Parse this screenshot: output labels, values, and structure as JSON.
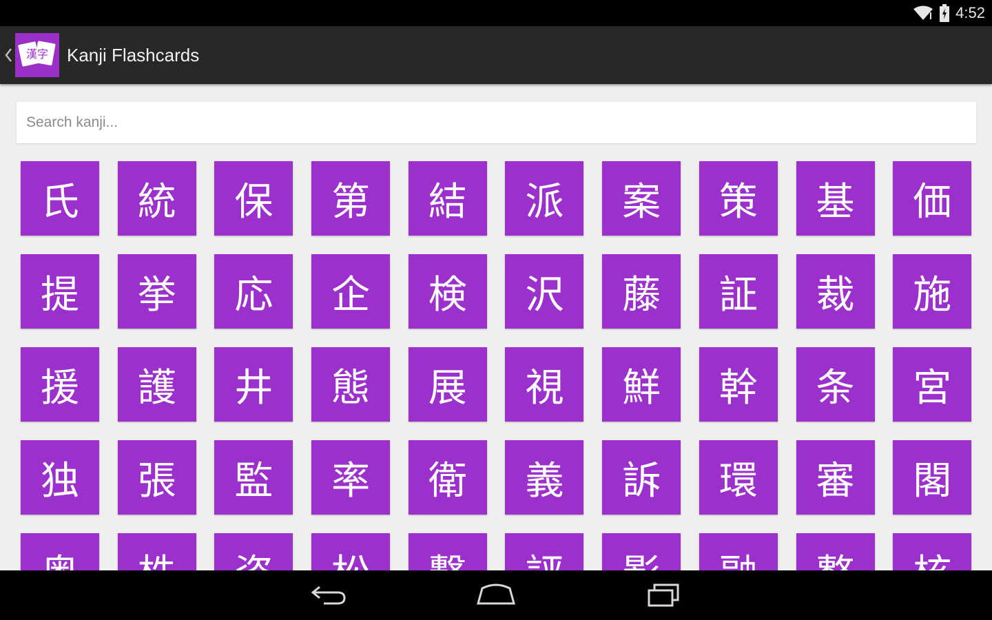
{
  "status_bar": {
    "time": "4:52",
    "icons": [
      "wifi-icon",
      "battery-icon"
    ]
  },
  "action_bar": {
    "title": "Kanji Flashcards",
    "logo_text": "漢字",
    "up_icon": "chevron-left-icon"
  },
  "search": {
    "placeholder": "Search kanji...",
    "value": ""
  },
  "colors": {
    "accent": "#9b30cc",
    "action_bar": "#282828",
    "background": "#efefef"
  },
  "kanji": [
    "氏",
    "統",
    "保",
    "第",
    "結",
    "派",
    "案",
    "策",
    "基",
    "価",
    "提",
    "挙",
    "応",
    "企",
    "検",
    "沢",
    "藤",
    "証",
    "裁",
    "施",
    "援",
    "護",
    "井",
    "態",
    "展",
    "視",
    "鮮",
    "幹",
    "条",
    "宮",
    "独",
    "張",
    "監",
    "率",
    "衛",
    "義",
    "訴",
    "環",
    "審",
    "閣",
    "奥",
    "株",
    "姿",
    "松",
    "撃",
    "評",
    "影",
    "融",
    "整",
    "核"
  ],
  "nav_bar": {
    "icons": [
      "back-icon",
      "home-icon",
      "recents-icon"
    ]
  }
}
